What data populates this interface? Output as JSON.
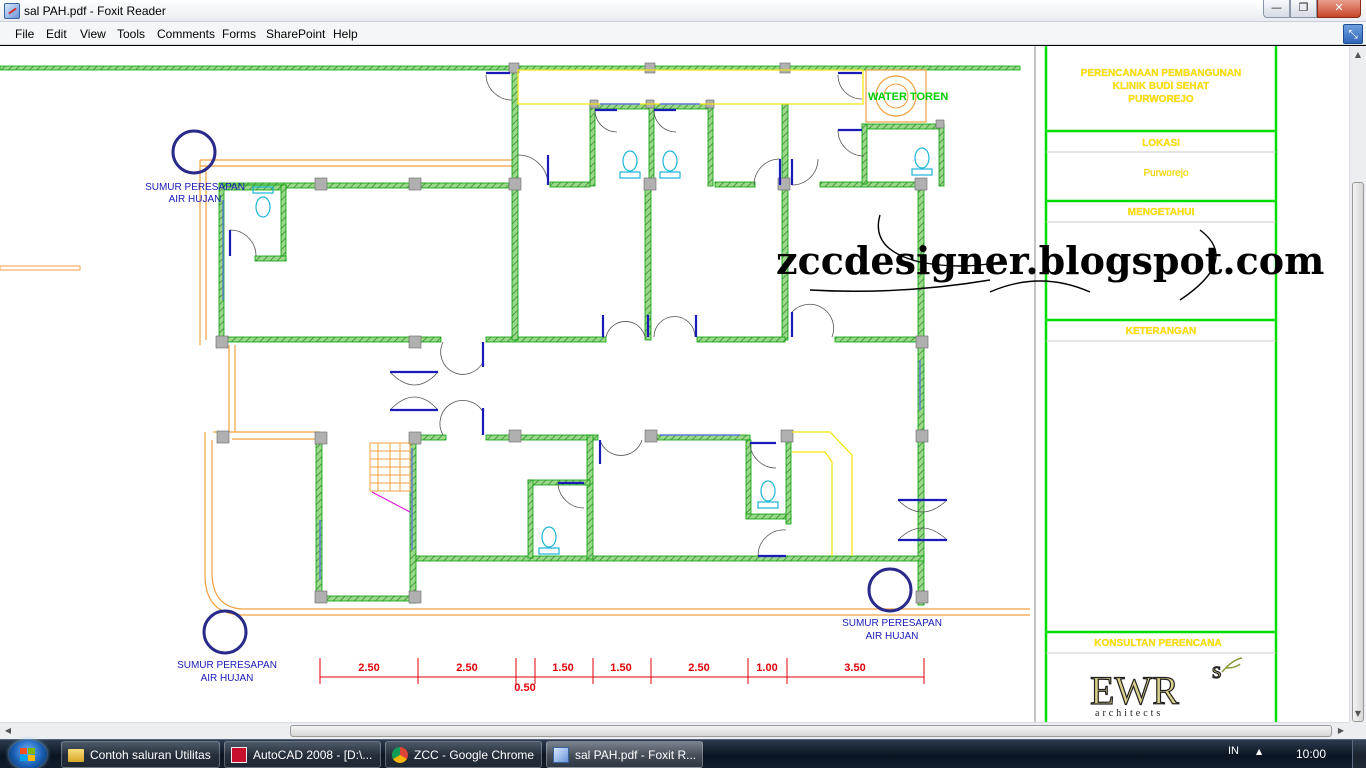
{
  "window": {
    "title": "sal PAH.pdf - Foxit Reader",
    "controls": {
      "minimize": "—",
      "maximize": "❐",
      "close": "✕"
    }
  },
  "menu": {
    "items": [
      "File",
      "Edit",
      "View",
      "Tools",
      "Comments",
      "Forms",
      "SharePoint",
      "Help"
    ]
  },
  "drawing": {
    "well_label_line1": "SUMUR PERESAPAN",
    "well_label_line2": "AIR HUJAN",
    "water_tower": "WATER TOREN",
    "dimensions": [
      "2.50",
      "2.50",
      "1.50",
      "1.50",
      "2.50",
      "1.00",
      "3.50"
    ],
    "dimension_small": "0.50",
    "watermark": "zccdesigner.blogspot.com"
  },
  "title_block": {
    "project_lines": [
      "PERENCANAAN PEMBANGUNAN",
      "KLINIK BUDI SEHAT",
      "PURWOREJO"
    ],
    "lokasi_label": "LOKASI",
    "lokasi_value": "Purworejo",
    "mengetahui_label": "MENGETAHUI",
    "keterangan_label": "KETERANGAN",
    "konsultan_label": "KONSULTAN PERENCANA",
    "logo_text": "EWR",
    "logo_sup": "s",
    "logo_sub": "architects"
  },
  "colors": {
    "wall_fill": "#8fcf7a",
    "wall_line": "#00c000",
    "door": "#1a1ab8",
    "orange": "#f0a040",
    "frame_green": "#00dd00"
  },
  "taskbar": {
    "items": [
      {
        "label": "Contoh saluran Utilitas",
        "icon": "folder-icon",
        "active": false
      },
      {
        "label": "AutoCAD 2008 - [D:\\...",
        "icon": "autocad-icon",
        "active": false
      },
      {
        "label": "ZCC - Google Chrome",
        "icon": "chrome-icon",
        "active": false
      },
      {
        "label": "sal PAH.pdf - Foxit R...",
        "icon": "foxit-icon",
        "active": true
      }
    ],
    "language": "IN",
    "clock": "10:00"
  }
}
